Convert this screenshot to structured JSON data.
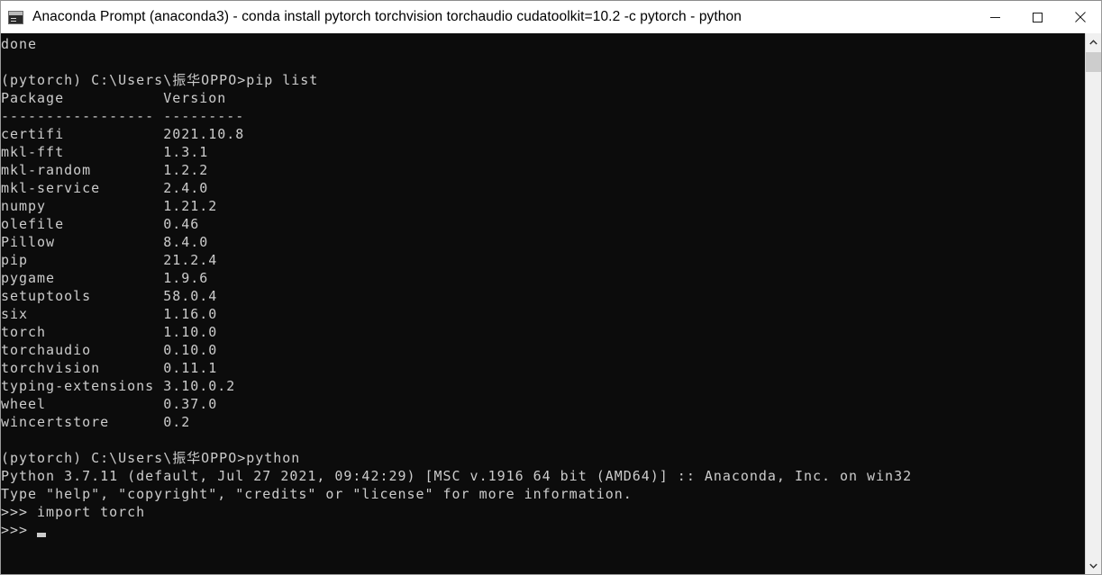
{
  "window": {
    "title": "Anaconda Prompt (anaconda3) - conda  install pytorch torchvision torchaudio cudatoolkit=10.2 -c pytorch - python",
    "icon": "console-icon",
    "controls": {
      "minimize": "Minimize",
      "maximize": "Maximize",
      "close": "Close"
    },
    "colors": {
      "titlebar_bg": "#ffffff",
      "console_bg": "#0c0c0c",
      "console_fg": "#cccccc",
      "scrollbar_track": "#f0f0f0",
      "scrollbar_thumb": "#cdcdcd"
    }
  },
  "console": {
    "prompt_env": "(pytorch)",
    "prompt_path": "C:\\Users\\振华OPPO>",
    "python_prompt": ">>>",
    "cursor": "_",
    "lines": [
      "done",
      "",
      "(pytorch) C:\\Users\\振华OPPO>pip list",
      "Package           Version",
      "----------------- ---------",
      "certifi           2021.10.8",
      "mkl-fft           1.3.1",
      "mkl-random        1.2.2",
      "mkl-service       2.4.0",
      "numpy             1.21.2",
      "olefile           0.46",
      "Pillow            8.4.0",
      "pip               21.2.4",
      "pygame            1.9.6",
      "setuptools        58.0.4",
      "six               1.16.0",
      "torch             1.10.0",
      "torchaudio        0.10.0",
      "torchvision       0.11.1",
      "typing-extensions 3.10.0.2",
      "wheel             0.37.0",
      "wincertstore      0.2",
      "",
      "(pytorch) C:\\Users\\振华OPPO>python",
      "Python 3.7.11 (default, Jul 27 2021, 09:42:29) [MSC v.1916 64 bit (AMD64)] :: Anaconda, Inc. on win32",
      "Type \"help\", \"copyright\", \"credits\" or \"license\" for more information.",
      ">>> import torch",
      ">>> "
    ],
    "commands": [
      "pip list",
      "python",
      "import torch"
    ],
    "package_table": {
      "headers": [
        "Package",
        "Version"
      ],
      "rows": [
        [
          "certifi",
          "2021.10.8"
        ],
        [
          "mkl-fft",
          "1.3.1"
        ],
        [
          "mkl-random",
          "1.2.2"
        ],
        [
          "mkl-service",
          "2.4.0"
        ],
        [
          "numpy",
          "1.21.2"
        ],
        [
          "olefile",
          "0.46"
        ],
        [
          "Pillow",
          "8.4.0"
        ],
        [
          "pip",
          "21.2.4"
        ],
        [
          "pygame",
          "1.9.6"
        ],
        [
          "setuptools",
          "58.0.4"
        ],
        [
          "six",
          "1.16.0"
        ],
        [
          "torch",
          "1.10.0"
        ],
        [
          "torchaudio",
          "0.10.0"
        ],
        [
          "torchvision",
          "0.11.1"
        ],
        [
          "typing-extensions",
          "3.10.0.2"
        ],
        [
          "wheel",
          "0.37.0"
        ],
        [
          "wincertstore",
          "0.2"
        ]
      ]
    },
    "python_banner": {
      "version": "Python 3.7.11",
      "build": "(default, Jul 27 2021, 09:42:29)",
      "compiler": "[MSC v.1916 64 bit (AMD64)]",
      "distribution": ":: Anaconda, Inc. on win32",
      "help_hint": "Type \"help\", \"copyright\", \"credits\" or \"license\" for more information."
    }
  },
  "scrollbar": {
    "up_arrow": "chevron-up-icon",
    "down_arrow": "chevron-down-icon",
    "thumb": "scrollbar-thumb"
  }
}
